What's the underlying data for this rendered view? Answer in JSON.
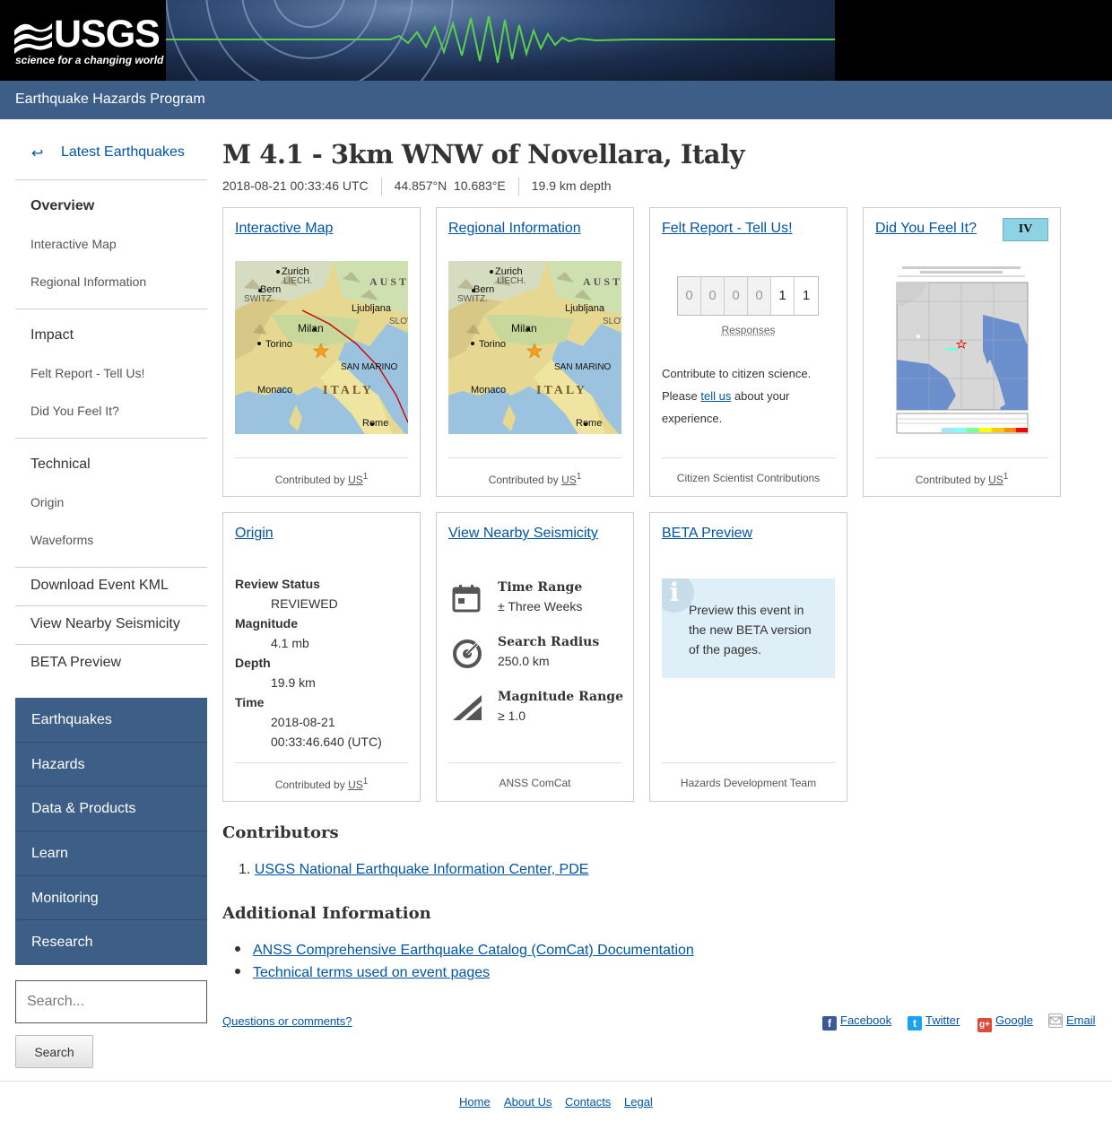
{
  "header": {
    "logo_text": "USGS",
    "logo_tagline": "science for a changing world",
    "program_title": "Earthquake Hazards Program"
  },
  "sidebar": {
    "back_label": "Latest Earthquakes",
    "back_icon": "return-arrow-icon",
    "overview": "Overview",
    "overview_items": [
      "Interactive Map",
      "Regional Information"
    ],
    "impact": "Impact",
    "impact_items": [
      "Felt Report - Tell Us!",
      "Did You Feel It?"
    ],
    "technical": "Technical",
    "technical_items": [
      "Origin",
      "Waveforms"
    ],
    "download_kml": "Download Event KML",
    "nearby": "View Nearby Seismicity",
    "beta": "BETA Preview"
  },
  "site_nav": [
    "Earthquakes",
    "Hazards",
    "Data & Products",
    "Learn",
    "Monitoring",
    "Research"
  ],
  "search": {
    "placeholder": "Search...",
    "button": "Search"
  },
  "event": {
    "title": "M 4.1 - 3km WNW of Novellara, Italy",
    "time": "2018-08-21 00:33:46 UTC",
    "lat": "44.857°N",
    "lon": "10.683°E",
    "depth": "19.9 km depth"
  },
  "cards": {
    "interactive_map": {
      "title": "Interactive Map",
      "footer": "Contributed by",
      "source": "US",
      "sup": "1"
    },
    "regional": {
      "title": "Regional Information",
      "footer": "Contributed by",
      "source": "US",
      "sup": "1"
    },
    "felt": {
      "title": "Felt Report - Tell Us!",
      "digits": [
        "0",
        "0",
        "0",
        "0",
        "1",
        "1"
      ],
      "responses_label": "Responses",
      "text_before": "Contribute to citizen science. Please ",
      "link": "tell us",
      "text_after": " about your experience.",
      "footer": "Citizen Scientist Contributions"
    },
    "dyfi": {
      "title": "Did You Feel It?",
      "intensity": "IV",
      "intensity_color": "#8ed3e3",
      "footer": "Contributed by",
      "source": "US",
      "sup": "1"
    },
    "origin": {
      "title": "Origin",
      "review_label": "Review Status",
      "review_value": "REVIEWED",
      "magnitude_label": "Magnitude",
      "magnitude_value": "4.1 mb",
      "depth_label": "Depth",
      "depth_value": "19.9 km",
      "time_label": "Time",
      "time_date": "2018-08-21",
      "time_clock": "00:33:46.640 (UTC)",
      "footer": "Contributed by",
      "source": "US",
      "sup": "1"
    },
    "nearby": {
      "title": "View Nearby Seismicity",
      "time_label": "Time Range",
      "time_value": "± Three Weeks",
      "radius_label": "Search Radius",
      "radius_value": "250.0 km",
      "mag_label": "Magnitude Range",
      "mag_value": "≥ 1.0",
      "footer": "ANSS ComCat"
    },
    "beta": {
      "title": "BETA Preview",
      "text": "Preview this event in the new BETA version of the pages.",
      "footer": "Hazards Development Team"
    }
  },
  "map_labels": {
    "zurich": "Zurich",
    "liech": "LIECH.",
    "bern": "Bern",
    "switz": "SWITZ.",
    "austr": "AUSTR",
    "ljubljana": "Ljubljana",
    "slov": "SLOV",
    "milan": "Milan",
    "torino": "Torino",
    "san_marino": "SAN MARINO",
    "monaco": "Monaco",
    "italy": "ITALY",
    "rome": "Rome"
  },
  "contributors": {
    "heading": "Contributors",
    "items": [
      "USGS National Earthquake Information Center, PDE"
    ]
  },
  "additional": {
    "heading": "Additional Information",
    "items": [
      "ANSS Comprehensive Earthquake Catalog (ComCat) Documentation",
      "Technical terms used on event pages"
    ]
  },
  "questions_link": "Questions or comments?",
  "share": [
    {
      "label": "Facebook",
      "icon": "facebook-icon",
      "color": "#3b5998"
    },
    {
      "label": "Twitter",
      "icon": "twitter-icon",
      "color": "#1da1f2"
    },
    {
      "label": "Google",
      "icon": "google-plus-icon",
      "color": "#dd4b39"
    },
    {
      "label": "Email",
      "icon": "email-icon",
      "color": "#999999"
    }
  ],
  "footer_links": [
    "Home",
    "About Us",
    "Contacts",
    "Legal"
  ]
}
